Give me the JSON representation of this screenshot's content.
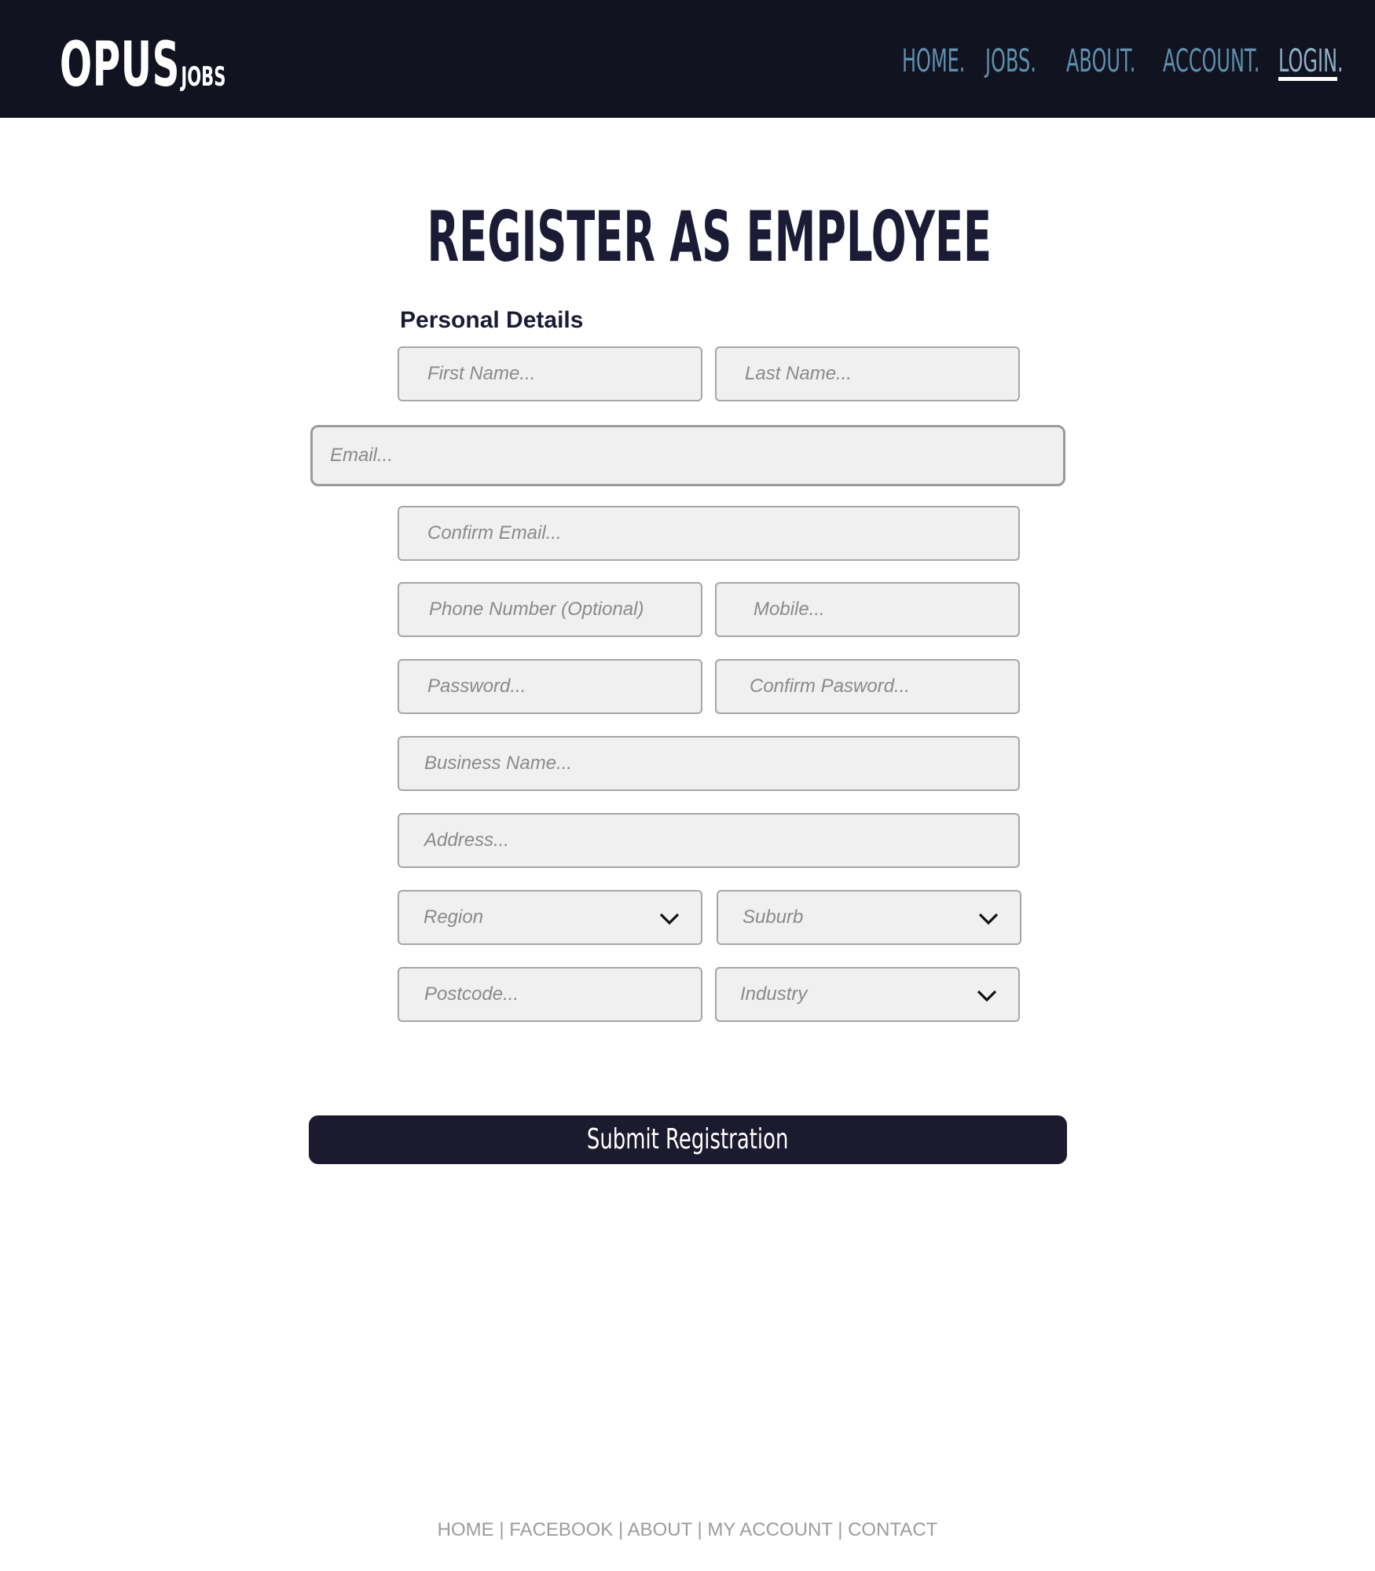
{
  "header": {
    "logo_main": "OPUS",
    "logo_sub": "JOBS",
    "nav": [
      {
        "label": "HOME."
      },
      {
        "label": "JOBS."
      },
      {
        "label": "ABOUT."
      },
      {
        "label": "ACCOUNT."
      },
      {
        "label": "LOGIN."
      }
    ],
    "active_nav": "LOGIN."
  },
  "title": "REGISTER AS EMPLOYEE",
  "section_label": "Personal Details",
  "form": {
    "first_name_placeholder": "First Name...",
    "last_name_placeholder": "Last Name...",
    "email_placeholder": "Email...",
    "confirm_email_placeholder": "Confirm Email...",
    "phone_placeholder": "Phone Number (Optional)",
    "mobile_placeholder": "Mobile...",
    "password_placeholder": "Password...",
    "confirm_password_placeholder": "Confirm Pasword...",
    "business_name_placeholder": "Business Name...",
    "address_placeholder": "Address...",
    "region_selected": "Region",
    "suburb_selected": "Suburb",
    "postcode_placeholder": "Postcode...",
    "industry_selected": "Industry",
    "chevron_icon": "chevron-down-icon"
  },
  "submit_label": "Submit Registration",
  "footer": {
    "links": [
      "HOME",
      "FACEBOOK",
      "ABOUT",
      "MY ACCOUNT",
      "CONTACT"
    ],
    "separator": "|"
  },
  "colors": {
    "header_bg": "#121320",
    "nav_link": "#5e8fad",
    "title": "#1b1b35",
    "button_bg": "#1b1a2e",
    "field_bg": "#f0f0f0"
  }
}
